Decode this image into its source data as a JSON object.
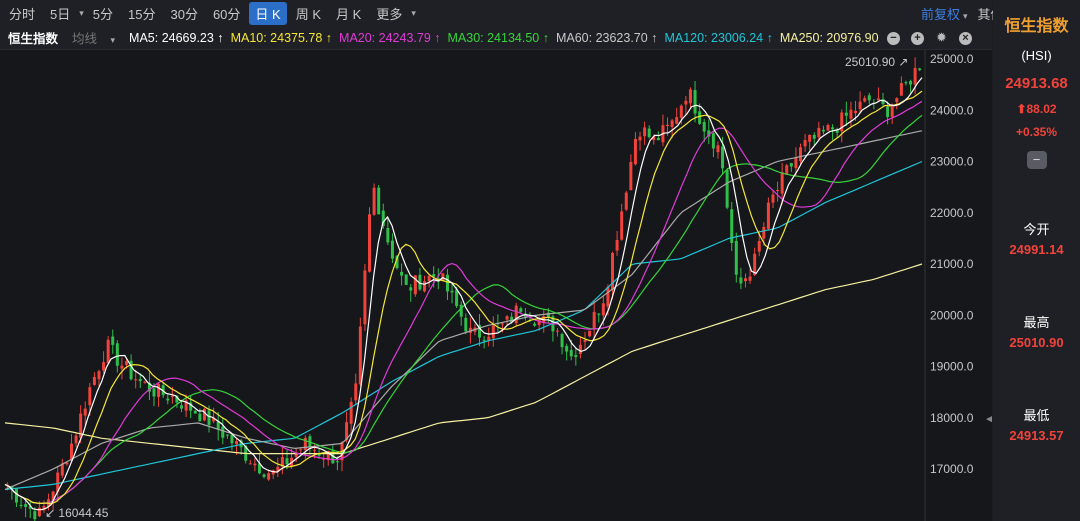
{
  "tabs": [
    "分时",
    "5日",
    "5分",
    "15分",
    "30分",
    "60分",
    "日 K",
    "周 K",
    "月 K",
    "更多"
  ],
  "active_tab": 6,
  "top_right": {
    "adjust": "前复权",
    "other": "其他"
  },
  "ma_bar": {
    "name": "恒生指数",
    "mode": "均线",
    "items": [
      {
        "label": "MA5: 24669.23 ↑",
        "color": "#ffffff"
      },
      {
        "label": "MA10: 24375.78 ↑",
        "color": "#f5e634"
      },
      {
        "label": "MA20: 24243.79 ↑",
        "color": "#e03ad8"
      },
      {
        "label": "MA30: 24134.50 ↑",
        "color": "#36d43a"
      },
      {
        "label": "MA60: 23623.70 ↑",
        "color": "#c8c8c8"
      },
      {
        "label": "MA120: 23006.24 ↑",
        "color": "#1fc6d8"
      },
      {
        "label": "MA250: 20976.90",
        "color": "#f5f0a0"
      }
    ]
  },
  "side": {
    "title": "恒生指数",
    "code": "(HSI)",
    "price": "24913.68",
    "change": "⬆88.02",
    "pct": "+0.35%",
    "open_label": "今开",
    "open": "24991.14",
    "high_label": "最高",
    "high": "25010.90",
    "low_label": "最低",
    "low": "24913.57"
  },
  "chart_data": {
    "type": "candlestick",
    "y_ticks": [
      "25000.0",
      "24000.0",
      "23000.0",
      "22000.0",
      "21000.0",
      "20000.0",
      "19000.0",
      "18000.0",
      "17000.0"
    ],
    "ylim": [
      16000,
      25800
    ],
    "max_label": "25010.90",
    "min_label": "16044.45",
    "close_keypoints": [
      16700,
      16300,
      16100,
      16800,
      17600,
      18600,
      19400,
      19000,
      18700,
      18500,
      18400,
      18200,
      18000,
      17700,
      17400,
      17100,
      16900,
      17200,
      17500,
      17300,
      17200,
      18500,
      22600,
      21400,
      20500,
      20700,
      20800,
      20200,
      19600,
      19700,
      19800,
      20200,
      19900,
      19800,
      19200,
      19700,
      20400,
      22000,
      23700,
      23400,
      23700,
      24400,
      23700,
      23200,
      20500,
      21000,
      22200,
      22800,
      23300,
      23500,
      23700,
      24000,
      24200,
      24000,
      24400,
      24900
    ],
    "ma60": [
      16600,
      17000,
      17500,
      17800,
      17900,
      17600,
      17400,
      17500,
      18600,
      19500,
      19800,
      20000,
      20100,
      20800,
      22000,
      22600,
      23000,
      23200,
      23400,
      23600
    ],
    "ma120": [
      16600,
      16700,
      16900,
      17100,
      17300,
      17500,
      17600,
      18100,
      18700,
      19200,
      19500,
      19700,
      20100,
      21000,
      21100,
      21500,
      21700,
      22200,
      22600,
      23000
    ],
    "ma250": [
      17900,
      17800,
      17600,
      17500,
      17400,
      17300,
      17300,
      17300,
      17600,
      17900,
      18000,
      18300,
      18800,
      19300,
      19600,
      19900,
      20200,
      20500,
      20700,
      21000
    ]
  }
}
